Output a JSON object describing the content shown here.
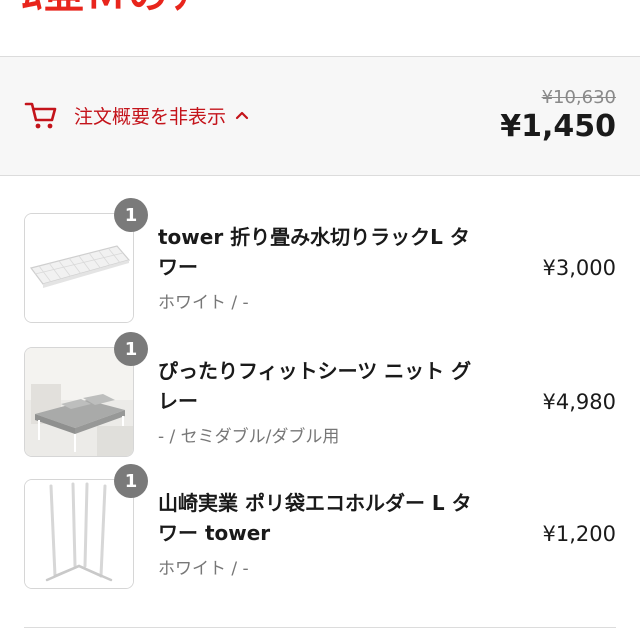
{
  "header": {
    "logo_fragment": "rakuten"
  },
  "summary": {
    "cart_icon": "cart-icon",
    "toggle_label": "注文概要を非表示",
    "chevron_icon": "chevron-up-icon",
    "original_price": "¥10,630",
    "total_price": "¥1,450",
    "accent_color": "#c4141b"
  },
  "items": [
    {
      "title": "tower 折り畳み水切りラックL タワー",
      "variant": "ホワイト / -",
      "price": "¥3,000",
      "quantity": "1",
      "image": "white-folding-rack"
    },
    {
      "title": "ぴったりフィットシーツ ニット グレー",
      "variant": "- / セミダブル/ダブル用",
      "price": "¥4,980",
      "quantity": "1",
      "image": "bed-gray-sheet"
    },
    {
      "title": "山崎実業 ポリ袋エコホルダー L タワー tower",
      "variant": "ホワイト / -",
      "price": "¥1,200",
      "quantity": "1",
      "image": "white-bag-holder"
    }
  ]
}
